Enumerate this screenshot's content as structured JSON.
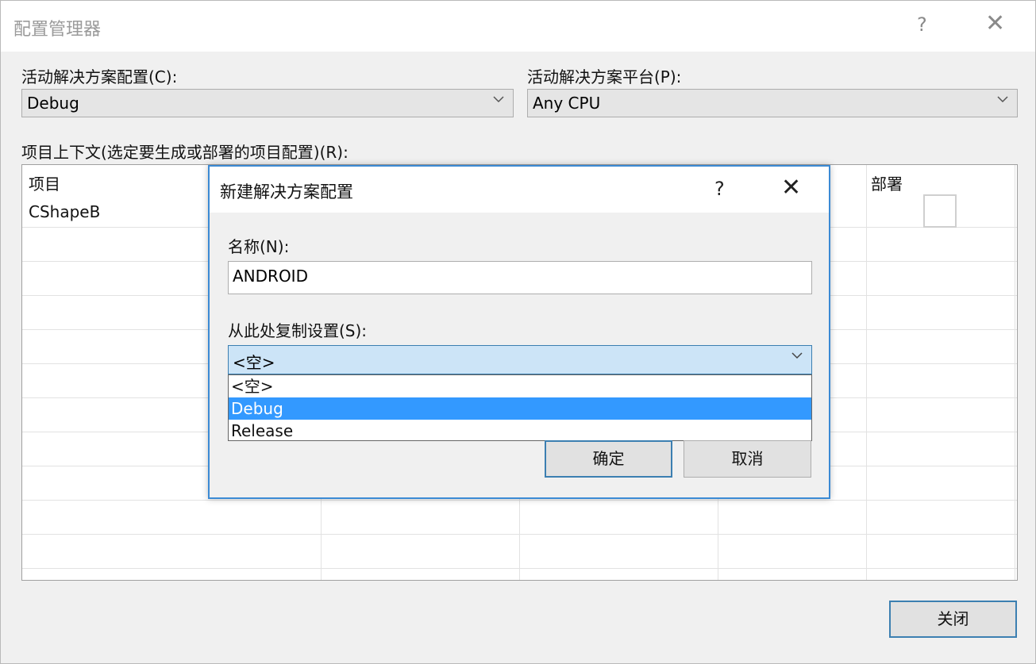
{
  "window": {
    "title": "配置管理器",
    "help_glyph": "?",
    "close_glyph": "✕"
  },
  "active_config": {
    "label": "活动解决方案配置(C):",
    "value": "Debug"
  },
  "active_platform": {
    "label": "活动解决方案平台(P):",
    "value": "Any CPU"
  },
  "project_context": {
    "label": "项目上下文(选定要生成或部署的项目配置)(R):",
    "columns": [
      "项目",
      "部署"
    ],
    "rows": [
      {
        "project": "CShapeB",
        "deploy_checked": false
      }
    ]
  },
  "close_button": "关闭",
  "modal": {
    "title": "新建解决方案配置",
    "help_glyph": "?",
    "close_glyph": "✕",
    "name_label": "名称(N):",
    "name_value": "ANDROID",
    "copy_label": "从此处复制设置(S):",
    "copy_value": "<空>",
    "copy_options": [
      "<空>",
      "Debug",
      "Release"
    ],
    "highlighted_option": "Debug",
    "ok_button": "确定",
    "cancel_button": "取消"
  },
  "icons": {
    "chevron": "chevron-down-icon"
  },
  "colors": {
    "accent": "#3b8ad4",
    "selection": "#3399ff",
    "combo_focus": "#cce4f7"
  }
}
